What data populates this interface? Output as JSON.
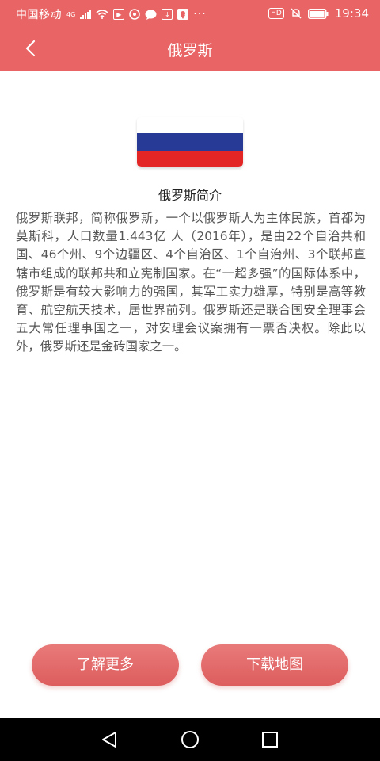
{
  "status_bar": {
    "carrier": "中国移动",
    "network": "4G",
    "hd_label": "HD",
    "time": "19:34",
    "more_dots": "···"
  },
  "header": {
    "title": "俄罗斯"
  },
  "flag": {
    "colors": [
      "#ffffff",
      "#263a96",
      "#e42525"
    ]
  },
  "intro": {
    "title": "俄罗斯简介",
    "text": "俄罗斯联邦，简称俄罗斯，一个以俄罗斯人为主体民族，首都为莫斯科，人口数量1.443亿 人（2016年），是由22个自治共和国、46个州、9个边疆区、4个自治区、1个自治州、3个联邦直辖市组成的联邦共和立宪制国家。在“一超多强”的国际体系中，俄罗斯是有较大影响力的强国，其军工实力雄厚，特别是高等教育、航空航天技术，居世界前列。俄罗斯还是联合国安全理事会五大常任理事国之一，对安理会议案拥有一票否决权。除此以外，俄罗斯还是金砖国家之一。"
  },
  "buttons": {
    "learn_more": "了解更多",
    "download_map": "下载地图"
  },
  "theme": {
    "accent": "#e96565"
  }
}
